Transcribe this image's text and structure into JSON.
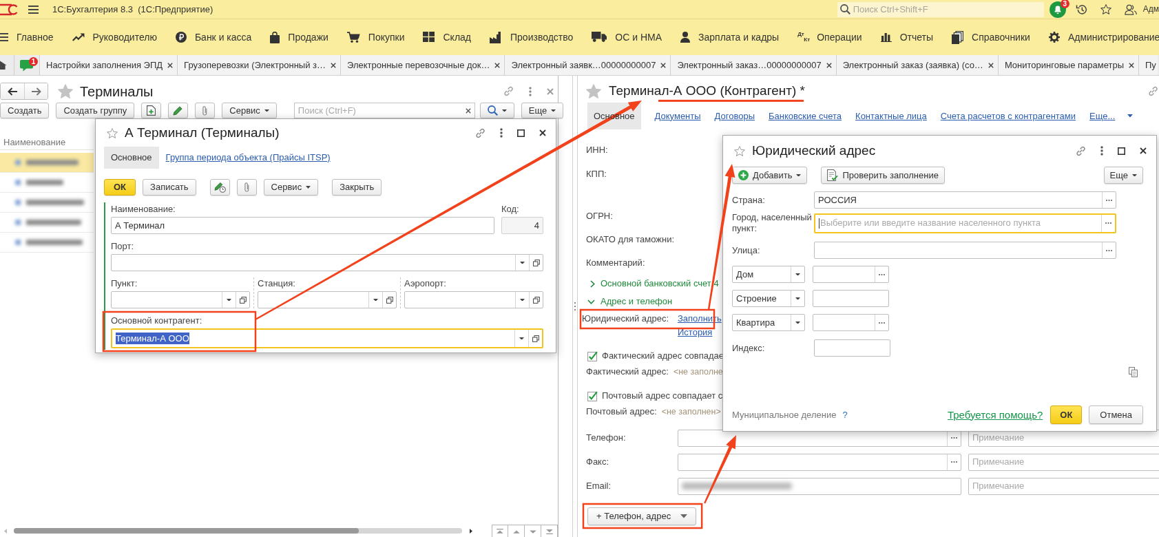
{
  "app": {
    "title": "1С:Бухгалтерия 8.3  (1С:Предприятие)",
    "search_placeholder": "Поиск Ctrl+Shift+F",
    "notification_count": "3",
    "user": "Адм"
  },
  "sections": [
    {
      "label": "Главное"
    },
    {
      "label": "Руководителю"
    },
    {
      "label": "Банк и касса"
    },
    {
      "label": "Продажи"
    },
    {
      "label": "Покупки"
    },
    {
      "label": "Склад"
    },
    {
      "label": "Производство"
    },
    {
      "label": "ОС и НМА"
    },
    {
      "label": "Зарплата и кадры"
    },
    {
      "label": "Операции",
      "icon_text": [
        "Дт",
        "Кт"
      ]
    },
    {
      "label": "Отчеты"
    },
    {
      "label": "Справочники"
    },
    {
      "label": "Администрирование"
    }
  ],
  "open_windows": {
    "messages_count": "1",
    "tabs": [
      {
        "label": "Настройки заполнения ЭПД",
        "closable": true
      },
      {
        "label": "Грузоперевозки (Электронный з…",
        "closable": true
      },
      {
        "label": "Электронные перевозочные док…",
        "closable": true
      },
      {
        "label": "Электронный заявк…00000000007",
        "closable": true
      },
      {
        "label": "Электронный заказ…00000000007",
        "closable": true
      },
      {
        "label": "Электронный заказ (заявка) (со…",
        "closable": true
      },
      {
        "label": "Мониторинговые параметры",
        "closable": true
      },
      {
        "label": "Пу",
        "closable": false
      }
    ]
  },
  "list_form": {
    "title": "Терминалы",
    "toolbar": {
      "create": "Создать",
      "create_group": "Создать группу",
      "service": "Сервис",
      "search_placeholder": "Поиск (Ctrl+F)",
      "more": "Еще"
    },
    "column": "Наименование",
    "rows": [
      {
        "selected": true
      },
      {
        "selected": false
      },
      {
        "selected": false
      },
      {
        "selected": false
      },
      {
        "selected": false
      }
    ]
  },
  "item_dialog": {
    "title": "А Терминал (Терминалы)",
    "tabs": [
      {
        "label": "Основное",
        "selected": true
      },
      {
        "label": "Группа периода объекта (Прайсы ITSP)",
        "selected": false
      }
    ],
    "commands": {
      "ok": "ОК",
      "save": "Записать",
      "service": "Сервис",
      "close": "Закрыть"
    },
    "rows": [
      [
        {
          "label": "Наименование:",
          "value": "А Терминал",
          "kind": "text",
          "focused": false
        },
        {
          "label": "Код:",
          "value": "4",
          "kind": "number",
          "focused": false
        }
      ],
      [
        {
          "label": "Порт:",
          "kind": "ref",
          "focused": false
        }
      ],
      [
        {
          "label": "Пункт:",
          "kind": "ref",
          "focused": false
        },
        {
          "label": "Станция:",
          "kind": "ref",
          "focused": false
        },
        {
          "label": "Аэропорт:",
          "kind": "ref",
          "focused": false
        }
      ],
      [
        {
          "label": "Основной контрагент:",
          "value": "Терминал-А ООО",
          "kind": "ref",
          "focused": true
        }
      ]
    ]
  },
  "counterparty_form": {
    "title": "Терминал-А ООО (Контрагент) *",
    "tabs": [
      {
        "label": "Основное",
        "selected": true,
        "kind": "tab"
      },
      {
        "label": "Документы",
        "selected": false,
        "kind": "tab"
      },
      {
        "label": "Договоры",
        "selected": false,
        "kind": "tab"
      },
      {
        "label": "Банковские счета",
        "selected": false,
        "kind": "tab"
      },
      {
        "label": "Контактные лица",
        "selected": false,
        "kind": "tab"
      },
      {
        "label": "Счета расчетов с контрагентами",
        "selected": false,
        "kind": "tab"
      },
      {
        "label": "Еще...",
        "selected": false,
        "kind": "menu"
      }
    ],
    "fields": [
      {
        "label": "ИНН:"
      },
      {
        "label": "КПП:"
      },
      {
        "label": "ОГРН:"
      },
      {
        "label": "ОКАТО для таможни:"
      },
      {
        "label": "Комментарий:"
      }
    ],
    "groups": [
      {
        "label": "Основной банковский счет 4",
        "expanded": false
      },
      {
        "label": "Адрес и телефон",
        "expanded": true
      }
    ],
    "legal_address": {
      "label": "Юридический адрес:",
      "fill": "Заполнить",
      "history": "История"
    },
    "address_matches": [
      {
        "label": "Фактический адрес совпадае",
        "checked": true,
        "address_label": "Фактический адрес:",
        "address_value": "<не заполне"
      },
      {
        "label": "Почтовый адрес совпадает с",
        "checked": true,
        "address_label": "Почтовый адрес:",
        "address_value": "<не заполнен>"
      }
    ],
    "contacts": [
      {
        "label": "Телефон:",
        "kind": "picker",
        "note_placeholder": "Примечание",
        "blurred": false
      },
      {
        "label": "Факс:",
        "kind": "picker",
        "note_placeholder": "Примечание",
        "blurred": false
      },
      {
        "label": "Email:",
        "kind": "plain",
        "note_placeholder": "Примечание",
        "blurred": true
      }
    ],
    "add_contact": "+ Телефон, адрес"
  },
  "address_dialog": {
    "title": "Юридический адрес",
    "add": "Добавить",
    "check": "Проверить заполнение",
    "more": "Еще",
    "fields": [
      {
        "label": "Страна:",
        "value": "РОССИЯ",
        "focused": false
      },
      {
        "label": "Город, населенный пункт:",
        "placeholder": "Выберите или введите название населенного пункта",
        "focused": true
      },
      {
        "label": "Улица:",
        "focused": false
      }
    ],
    "parts": [
      {
        "type": "Дом",
        "kind": "picker"
      },
      {
        "type": "Строение",
        "kind": "plain"
      },
      {
        "type": "Квартира",
        "kind": "picker"
      }
    ],
    "postcode_label": "Индекс:",
    "municipal": "Муниципальное деление",
    "municipal_help": "?",
    "help": "Требуется помощь?",
    "ok": "ОК",
    "cancel": "Отмена"
  }
}
